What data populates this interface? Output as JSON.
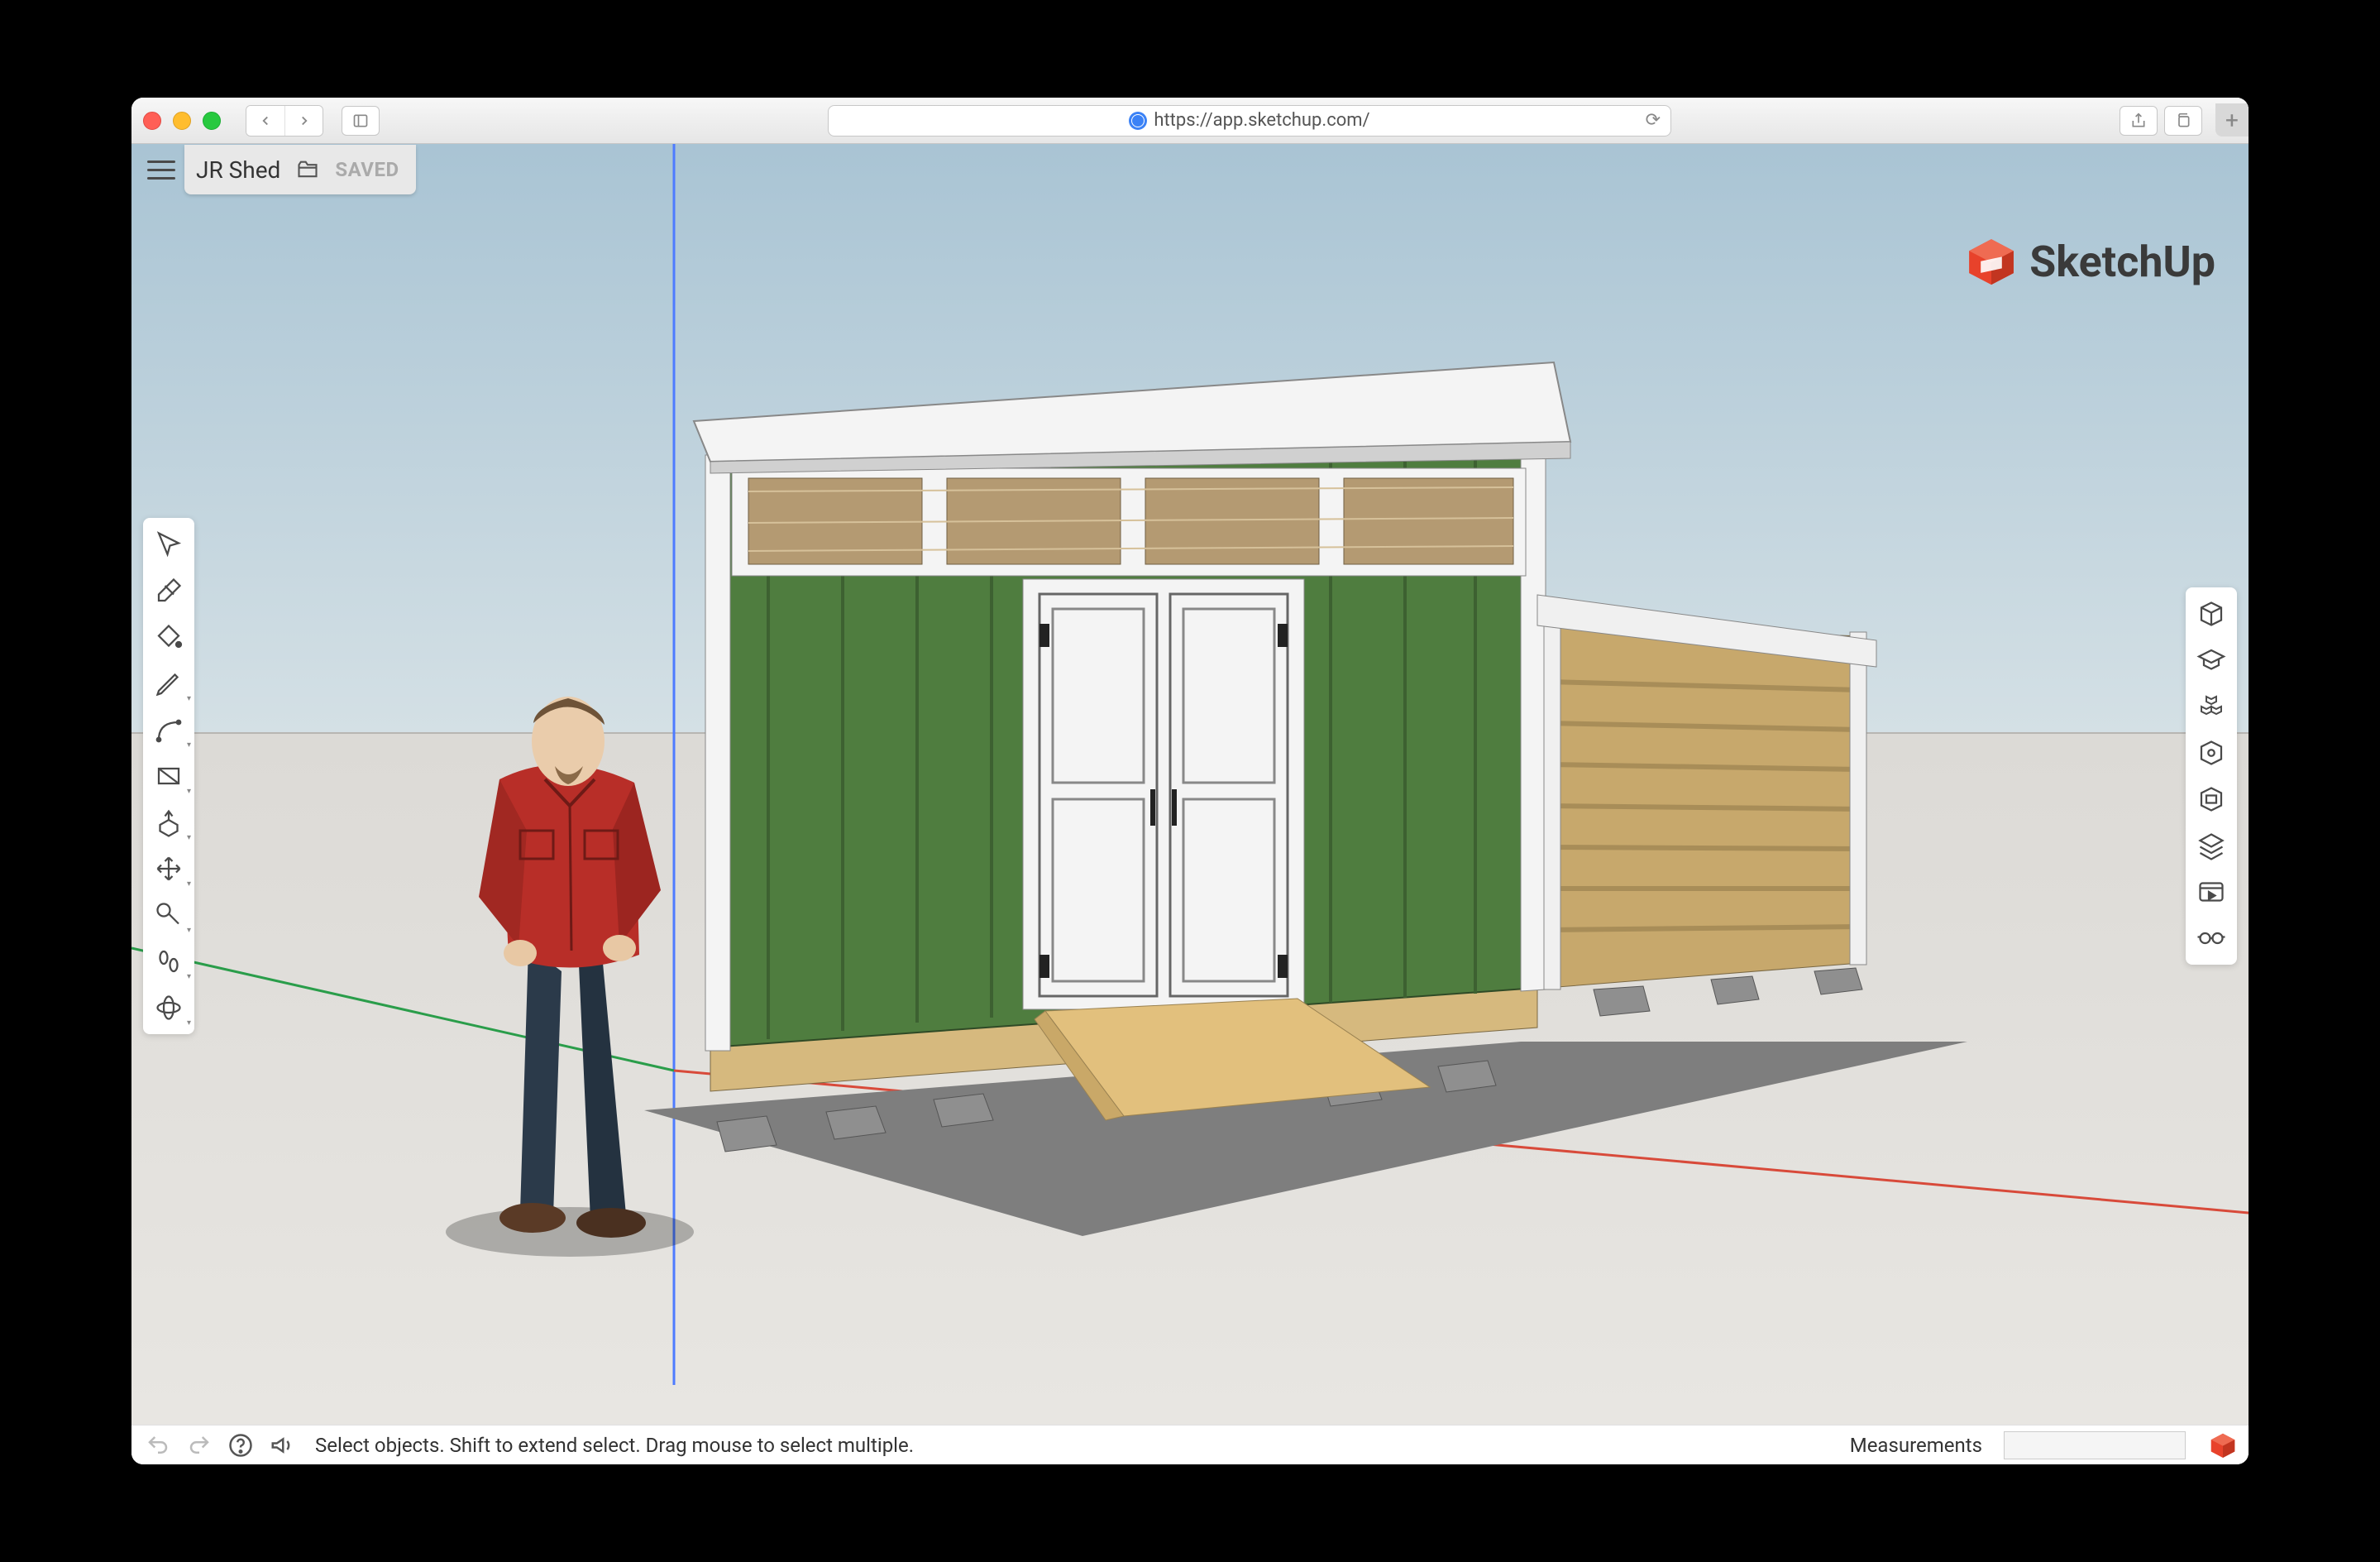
{
  "browser": {
    "url": "https://app.sketchup.com/"
  },
  "header": {
    "file_name": "JR Shed",
    "saved_label": "SAVED"
  },
  "brand": {
    "name": "SketchUp"
  },
  "left_tools": [
    {
      "name": "select-tool",
      "icon": "cursor"
    },
    {
      "name": "eraser-tool",
      "icon": "eraser"
    },
    {
      "name": "paint-bucket-tool",
      "icon": "bucket"
    },
    {
      "name": "pencil-tool",
      "icon": "pencil",
      "chevron": true
    },
    {
      "name": "arc-tool",
      "icon": "arc",
      "chevron": true
    },
    {
      "name": "rectangle-tool",
      "icon": "rect",
      "chevron": true
    },
    {
      "name": "push-pull-tool",
      "icon": "pushpull",
      "chevron": true
    },
    {
      "name": "move-tool",
      "icon": "move",
      "chevron": true
    },
    {
      "name": "tape-measure-tool",
      "icon": "tape",
      "chevron": true
    },
    {
      "name": "walk-tool",
      "icon": "walk",
      "chevron": true
    },
    {
      "name": "orbit-tool",
      "icon": "orbit",
      "chevron": true
    }
  ],
  "right_tools": [
    {
      "name": "entity-info-panel",
      "icon": "cube"
    },
    {
      "name": "instructor-panel",
      "icon": "grad"
    },
    {
      "name": "components-panel",
      "icon": "cubes"
    },
    {
      "name": "materials-panel",
      "icon": "box"
    },
    {
      "name": "styles-panel",
      "icon": "boxstyle"
    },
    {
      "name": "layers-panel",
      "icon": "layers"
    },
    {
      "name": "scenes-panel",
      "icon": "scenes"
    },
    {
      "name": "display-panel",
      "icon": "glasses"
    }
  ],
  "status": {
    "hint": "Select objects. Shift to extend select. Drag mouse to select multiple.",
    "measurements_label": "Measurements"
  }
}
